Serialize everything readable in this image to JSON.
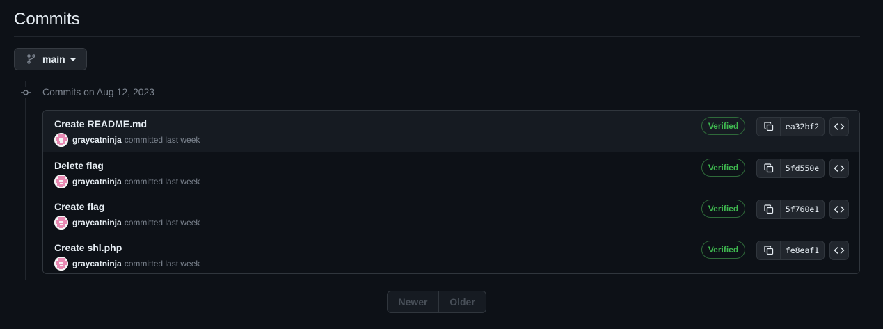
{
  "page": {
    "title": "Commits"
  },
  "branch": {
    "name": "main",
    "icon": "git-branch-icon"
  },
  "group": {
    "heading": "Commits on Aug 12, 2023"
  },
  "commits": [
    {
      "title": "Create README.md",
      "author": "graycatninja",
      "action": "committed last week",
      "badge": "Verified",
      "sha": "ea32bf2"
    },
    {
      "title": "Delete flag",
      "author": "graycatninja",
      "action": "committed last week",
      "badge": "Verified",
      "sha": "5fd550e"
    },
    {
      "title": "Create flag",
      "author": "graycatninja",
      "action": "committed last week",
      "badge": "Verified",
      "sha": "5f760e1"
    },
    {
      "title": "Create shl.php",
      "author": "graycatninja",
      "action": "committed last week",
      "badge": "Verified",
      "sha": "fe8eaf1"
    }
  ],
  "pagination": {
    "newer": "Newer",
    "older": "Older"
  },
  "colors": {
    "background": "#0d1117",
    "verified": "#3fb950",
    "avatar": "#e98bb4"
  }
}
